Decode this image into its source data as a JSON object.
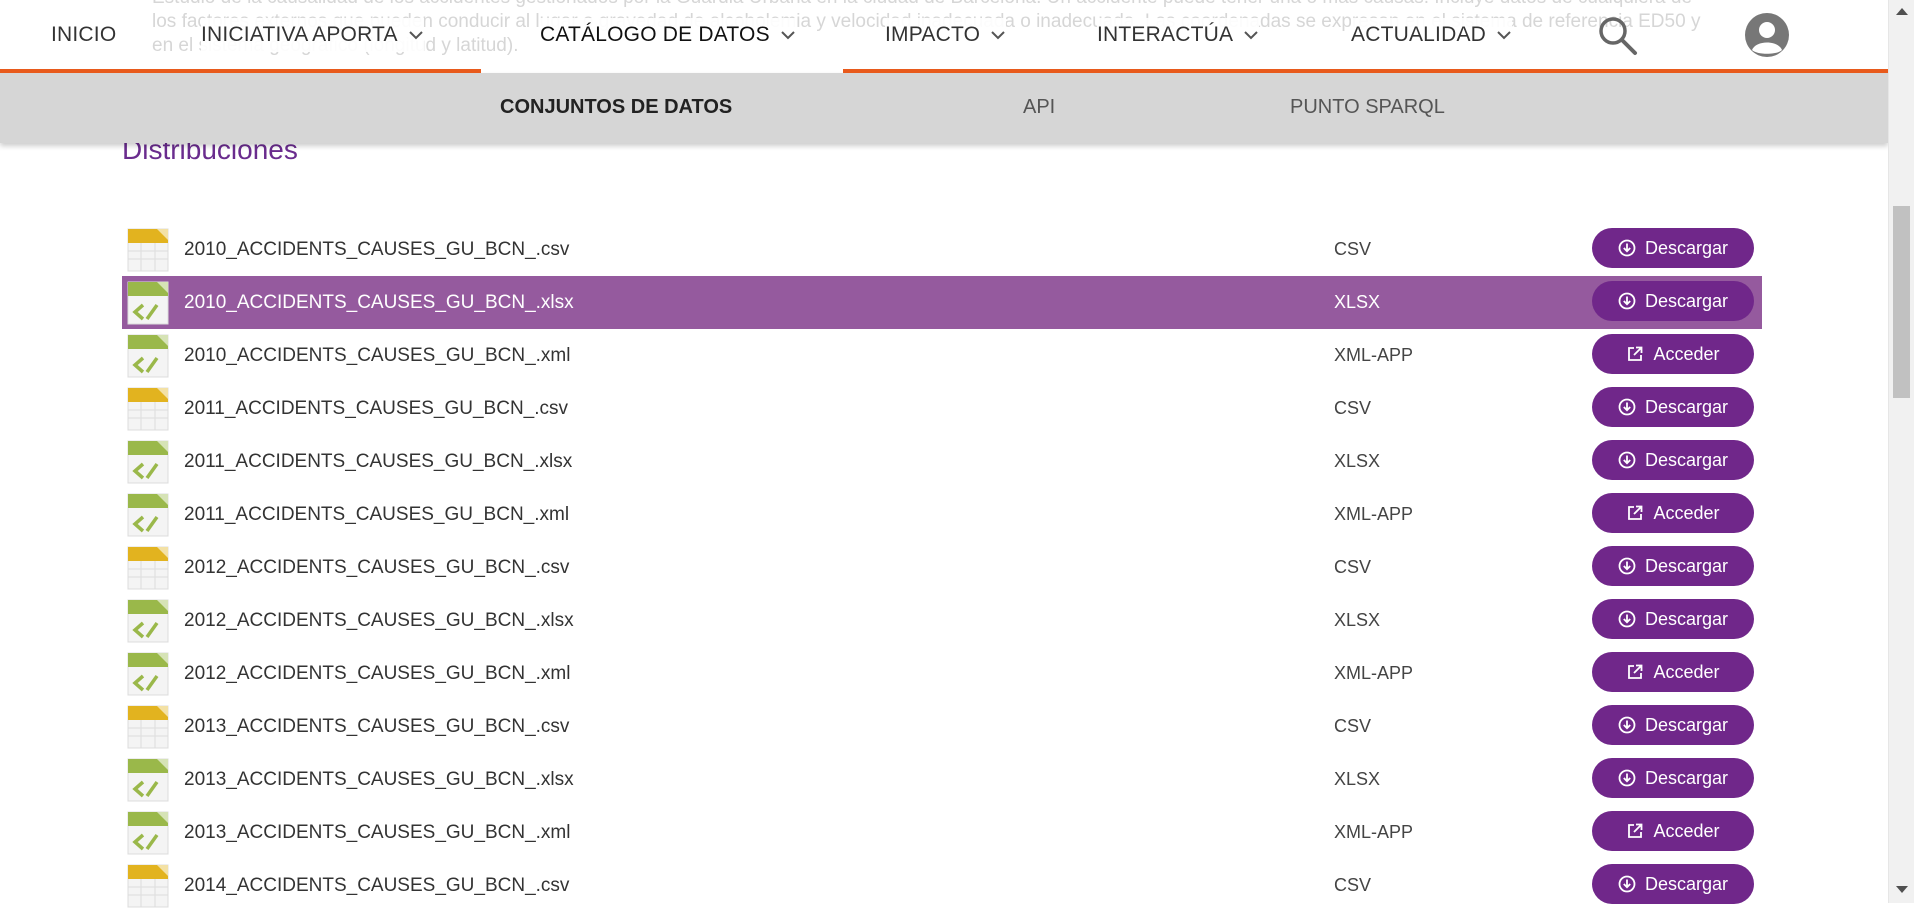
{
  "background_paragraph": "Estudio de la causalidad de los accidentes gestionados por la Guardia Urbana en la ciudad de Barcelona. Un accidente puede tener una o más causas. Incluye datos de cualquiera de los factores externos que pueden conducir al lugar o gravedad de alcoholemia y velocidad inadecuada o inadecuada. Las coordenadas se expresan en el sistema de referencia ED50 y en el sistema geográfico (longitud y latitud).",
  "topnav": {
    "items": [
      {
        "label": "INICIO"
      },
      {
        "label": "INICIATIVA APORTA"
      },
      {
        "label": "CATÁLOGO DE DATOS"
      },
      {
        "label": "IMPACTO"
      },
      {
        "label": "INTERACTÚA"
      },
      {
        "label": "ACTUALIDAD"
      }
    ],
    "search_icon": "search-icon",
    "user_icon": "user-avatar-icon"
  },
  "subnav": {
    "items": [
      {
        "label": "CONJUNTOS DE DATOS"
      },
      {
        "label": "API"
      },
      {
        "label": "PUNTO SPARQL"
      }
    ]
  },
  "section_title": "Distribuciones",
  "colors": {
    "accent": "#70278a",
    "selected_row": "#955a9e",
    "underline": "#e85a1c",
    "subnav_bg": "#d6d6d6",
    "csv_icon": "#e2b31f",
    "xml_icon": "#9ab84a"
  },
  "distributions": [
    {
      "name": "2010_ACCIDENTS_CAUSES_GU_BCN_.csv",
      "format": "CSV",
      "action": "Descargar",
      "icon": "csv-file-icon"
    },
    {
      "name": "2010_ACCIDENTS_CAUSES_GU_BCN_.xlsx",
      "format": "XLSX",
      "action": "Descargar",
      "icon": "xml-file-icon"
    },
    {
      "name": "2010_ACCIDENTS_CAUSES_GU_BCN_.xml",
      "format": "XML-APP",
      "action": "Acceder",
      "icon": "xml-file-icon"
    },
    {
      "name": "2011_ACCIDENTS_CAUSES_GU_BCN_.csv",
      "format": "CSV",
      "action": "Descargar",
      "icon": "csv-file-icon"
    },
    {
      "name": "2011_ACCIDENTS_CAUSES_GU_BCN_.xlsx",
      "format": "XLSX",
      "action": "Descargar",
      "icon": "xml-file-icon"
    },
    {
      "name": "2011_ACCIDENTS_CAUSES_GU_BCN_.xml",
      "format": "XML-APP",
      "action": "Acceder",
      "icon": "xml-file-icon"
    },
    {
      "name": "2012_ACCIDENTS_CAUSES_GU_BCN_.csv",
      "format": "CSV",
      "action": "Descargar",
      "icon": "csv-file-icon"
    },
    {
      "name": "2012_ACCIDENTS_CAUSES_GU_BCN_.xlsx",
      "format": "XLSX",
      "action": "Descargar",
      "icon": "xml-file-icon"
    },
    {
      "name": "2012_ACCIDENTS_CAUSES_GU_BCN_.xml",
      "format": "XML-APP",
      "action": "Acceder",
      "icon": "xml-file-icon"
    },
    {
      "name": "2013_ACCIDENTS_CAUSES_GU_BCN_.csv",
      "format": "CSV",
      "action": "Descargar",
      "icon": "csv-file-icon"
    },
    {
      "name": "2013_ACCIDENTS_CAUSES_GU_BCN_.xlsx",
      "format": "XLSX",
      "action": "Descargar",
      "icon": "xml-file-icon"
    },
    {
      "name": "2013_ACCIDENTS_CAUSES_GU_BCN_.xml",
      "format": "XML-APP",
      "action": "Acceder",
      "icon": "xml-file-icon"
    },
    {
      "name": "2014_ACCIDENTS_CAUSES_GU_BCN_.csv",
      "format": "CSV",
      "action": "Descargar",
      "icon": "csv-file-icon"
    }
  ]
}
